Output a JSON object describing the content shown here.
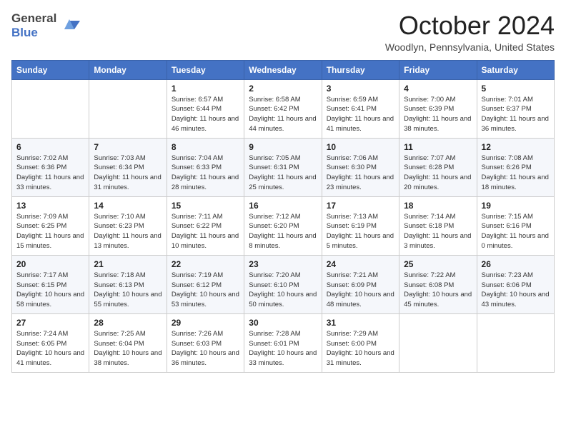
{
  "header": {
    "logo_general": "General",
    "logo_blue": "Blue",
    "month_title": "October 2024",
    "location": "Woodlyn, Pennsylvania, United States"
  },
  "calendar": {
    "days_of_week": [
      "Sunday",
      "Monday",
      "Tuesday",
      "Wednesday",
      "Thursday",
      "Friday",
      "Saturday"
    ],
    "weeks": [
      [
        {
          "day": "",
          "info": ""
        },
        {
          "day": "",
          "info": ""
        },
        {
          "day": "1",
          "info": "Sunrise: 6:57 AM\nSunset: 6:44 PM\nDaylight: 11 hours and 46 minutes."
        },
        {
          "day": "2",
          "info": "Sunrise: 6:58 AM\nSunset: 6:42 PM\nDaylight: 11 hours and 44 minutes."
        },
        {
          "day": "3",
          "info": "Sunrise: 6:59 AM\nSunset: 6:41 PM\nDaylight: 11 hours and 41 minutes."
        },
        {
          "day": "4",
          "info": "Sunrise: 7:00 AM\nSunset: 6:39 PM\nDaylight: 11 hours and 38 minutes."
        },
        {
          "day": "5",
          "info": "Sunrise: 7:01 AM\nSunset: 6:37 PM\nDaylight: 11 hours and 36 minutes."
        }
      ],
      [
        {
          "day": "6",
          "info": "Sunrise: 7:02 AM\nSunset: 6:36 PM\nDaylight: 11 hours and 33 minutes."
        },
        {
          "day": "7",
          "info": "Sunrise: 7:03 AM\nSunset: 6:34 PM\nDaylight: 11 hours and 31 minutes."
        },
        {
          "day": "8",
          "info": "Sunrise: 7:04 AM\nSunset: 6:33 PM\nDaylight: 11 hours and 28 minutes."
        },
        {
          "day": "9",
          "info": "Sunrise: 7:05 AM\nSunset: 6:31 PM\nDaylight: 11 hours and 25 minutes."
        },
        {
          "day": "10",
          "info": "Sunrise: 7:06 AM\nSunset: 6:30 PM\nDaylight: 11 hours and 23 minutes."
        },
        {
          "day": "11",
          "info": "Sunrise: 7:07 AM\nSunset: 6:28 PM\nDaylight: 11 hours and 20 minutes."
        },
        {
          "day": "12",
          "info": "Sunrise: 7:08 AM\nSunset: 6:26 PM\nDaylight: 11 hours and 18 minutes."
        }
      ],
      [
        {
          "day": "13",
          "info": "Sunrise: 7:09 AM\nSunset: 6:25 PM\nDaylight: 11 hours and 15 minutes."
        },
        {
          "day": "14",
          "info": "Sunrise: 7:10 AM\nSunset: 6:23 PM\nDaylight: 11 hours and 13 minutes."
        },
        {
          "day": "15",
          "info": "Sunrise: 7:11 AM\nSunset: 6:22 PM\nDaylight: 11 hours and 10 minutes."
        },
        {
          "day": "16",
          "info": "Sunrise: 7:12 AM\nSunset: 6:20 PM\nDaylight: 11 hours and 8 minutes."
        },
        {
          "day": "17",
          "info": "Sunrise: 7:13 AM\nSunset: 6:19 PM\nDaylight: 11 hours and 5 minutes."
        },
        {
          "day": "18",
          "info": "Sunrise: 7:14 AM\nSunset: 6:18 PM\nDaylight: 11 hours and 3 minutes."
        },
        {
          "day": "19",
          "info": "Sunrise: 7:15 AM\nSunset: 6:16 PM\nDaylight: 11 hours and 0 minutes."
        }
      ],
      [
        {
          "day": "20",
          "info": "Sunrise: 7:17 AM\nSunset: 6:15 PM\nDaylight: 10 hours and 58 minutes."
        },
        {
          "day": "21",
          "info": "Sunrise: 7:18 AM\nSunset: 6:13 PM\nDaylight: 10 hours and 55 minutes."
        },
        {
          "day": "22",
          "info": "Sunrise: 7:19 AM\nSunset: 6:12 PM\nDaylight: 10 hours and 53 minutes."
        },
        {
          "day": "23",
          "info": "Sunrise: 7:20 AM\nSunset: 6:10 PM\nDaylight: 10 hours and 50 minutes."
        },
        {
          "day": "24",
          "info": "Sunrise: 7:21 AM\nSunset: 6:09 PM\nDaylight: 10 hours and 48 minutes."
        },
        {
          "day": "25",
          "info": "Sunrise: 7:22 AM\nSunset: 6:08 PM\nDaylight: 10 hours and 45 minutes."
        },
        {
          "day": "26",
          "info": "Sunrise: 7:23 AM\nSunset: 6:06 PM\nDaylight: 10 hours and 43 minutes."
        }
      ],
      [
        {
          "day": "27",
          "info": "Sunrise: 7:24 AM\nSunset: 6:05 PM\nDaylight: 10 hours and 41 minutes."
        },
        {
          "day": "28",
          "info": "Sunrise: 7:25 AM\nSunset: 6:04 PM\nDaylight: 10 hours and 38 minutes."
        },
        {
          "day": "29",
          "info": "Sunrise: 7:26 AM\nSunset: 6:03 PM\nDaylight: 10 hours and 36 minutes."
        },
        {
          "day": "30",
          "info": "Sunrise: 7:28 AM\nSunset: 6:01 PM\nDaylight: 10 hours and 33 minutes."
        },
        {
          "day": "31",
          "info": "Sunrise: 7:29 AM\nSunset: 6:00 PM\nDaylight: 10 hours and 31 minutes."
        },
        {
          "day": "",
          "info": ""
        },
        {
          "day": "",
          "info": ""
        }
      ]
    ]
  }
}
